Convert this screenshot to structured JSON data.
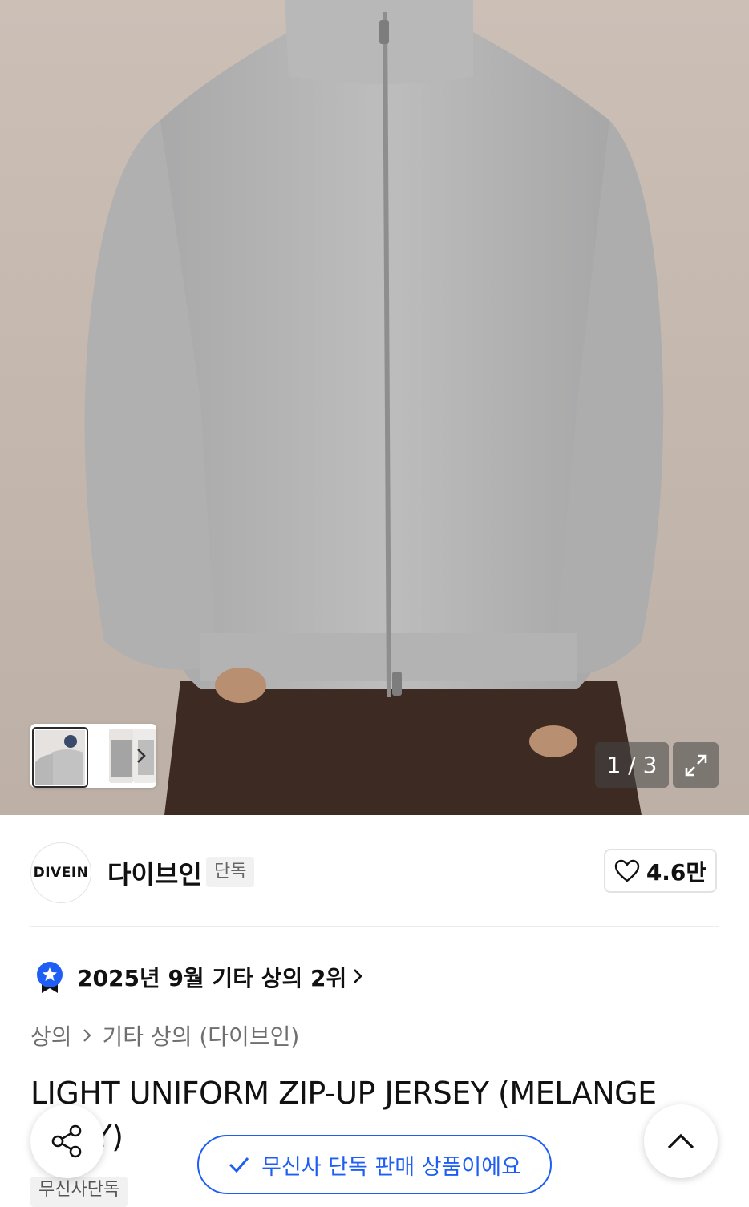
{
  "gallery": {
    "counter": "1 / 3",
    "thumbnail_count": 3
  },
  "brand": {
    "logo_text": "DIVEIN",
    "name": "다이브인",
    "badge": "단독",
    "likes": "4.6만"
  },
  "ranking": {
    "text": "2025년 9월 기타 상의 2위"
  },
  "breadcrumb": {
    "level1": "상의",
    "level2": "기타 상의 (다이브인)"
  },
  "product": {
    "title": "LIGHT UNIFORM ZIP-UP JERSEY (MELANGE GREY)",
    "exclusive_tag": "무신사단독"
  },
  "floating": {
    "exclusive_notice": "무신사 단독 판매 상품이에요"
  },
  "colors": {
    "accent_blue": "#1e5ef5",
    "badge_bg": "#f1f1f1"
  },
  "icons": [
    "chevron-right-icon",
    "expand-icon",
    "heart-icon",
    "ranking-badge-icon",
    "share-icon",
    "chevron-up-icon",
    "check-icon"
  ]
}
